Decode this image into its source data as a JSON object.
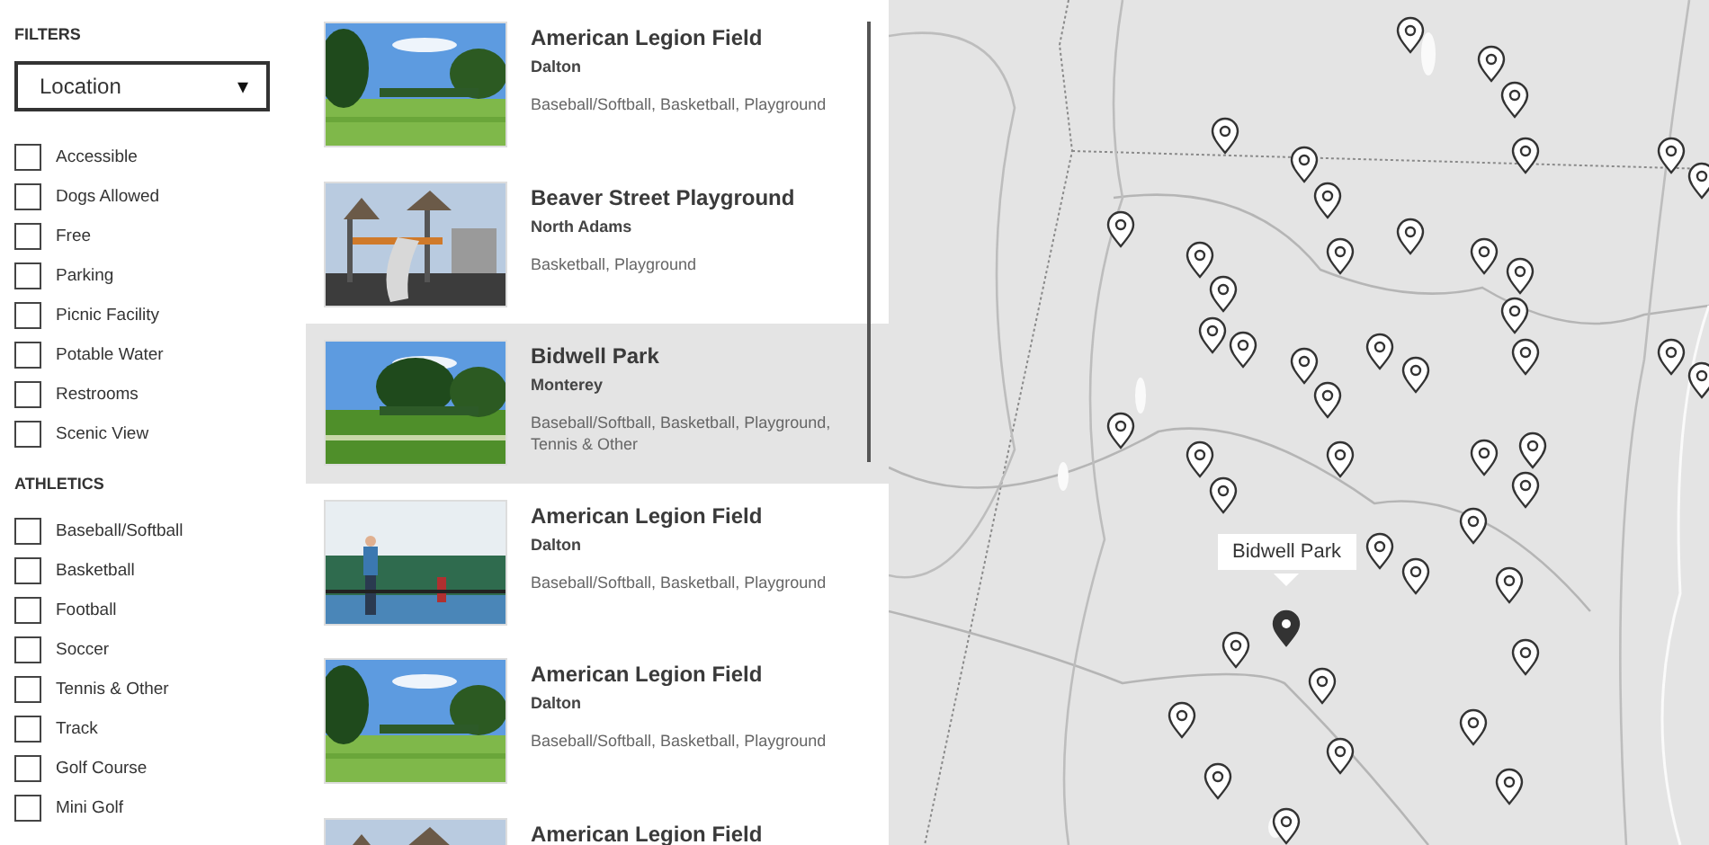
{
  "filters": {
    "title": "FILTERS",
    "location": {
      "value": "Location",
      "caret": "▾"
    },
    "amenities": [
      {
        "label": "Accessible",
        "checked": false
      },
      {
        "label": "Dogs Allowed",
        "checked": false
      },
      {
        "label": "Free",
        "checked": false
      },
      {
        "label": "Parking",
        "checked": false
      },
      {
        "label": "Picnic Facility",
        "checked": false
      },
      {
        "label": "Potable Water",
        "checked": false
      },
      {
        "label": "Restrooms",
        "checked": false
      },
      {
        "label": "Scenic View",
        "checked": false
      }
    ],
    "athletics_title": "ATHLETICS",
    "athletics": [
      {
        "label": "Baseball/Softball",
        "checked": false
      },
      {
        "label": "Basketball",
        "checked": false
      },
      {
        "label": "Football",
        "checked": false
      },
      {
        "label": "Soccer",
        "checked": false
      },
      {
        "label": "Tennis & Other",
        "checked": false
      },
      {
        "label": "Track",
        "checked": false
      },
      {
        "label": "Golf Course",
        "checked": false
      },
      {
        "label": "Mini Golf",
        "checked": false
      }
    ]
  },
  "results": [
    {
      "name": "American Legion Field",
      "town": "Dalton",
      "tags": "Baseball/Softball, Basketball, Playground",
      "selected": false
    },
    {
      "name": "Beaver Street Playground",
      "town": "North Adams",
      "tags": "Basketball, Playground",
      "selected": false
    },
    {
      "name": "Bidwell Park",
      "town": "Monterey",
      "tags": "Baseball/Softball, Basketball, Playground, Tennis & Other",
      "selected": true
    },
    {
      "name": "American Legion Field",
      "town": "Dalton",
      "tags": "Baseball/Softball, Basketball, Playground",
      "selected": false
    },
    {
      "name": "American Legion Field",
      "town": "Dalton",
      "tags": "Baseball/Softball, Basketball, Playground",
      "selected": false
    },
    {
      "name": "American Legion Field",
      "selected": false
    }
  ],
  "map": {
    "callout": "Bidwell Park"
  }
}
